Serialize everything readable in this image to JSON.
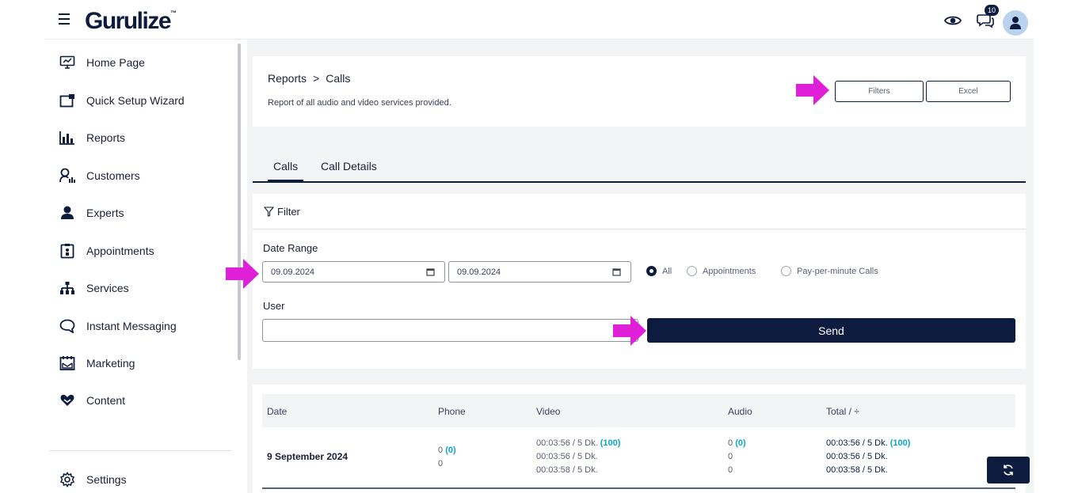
{
  "header": {
    "logo_text": "Gurulize",
    "logo_tm": "™",
    "notification_count": "10"
  },
  "sidebar": {
    "items": [
      {
        "label": "Home Page",
        "icon": "monitor-chart-icon"
      },
      {
        "label": "Quick Setup Wizard",
        "icon": "window-add-icon"
      },
      {
        "label": "Reports",
        "icon": "bar-chart-icon"
      },
      {
        "label": "Customers",
        "icon": "user-chart-icon"
      },
      {
        "label": "Experts",
        "icon": "user-icon"
      },
      {
        "label": "Appointments",
        "icon": "clipboard-user-icon"
      },
      {
        "label": "Services",
        "icon": "hierarchy-icon"
      },
      {
        "label": "Instant Messaging",
        "icon": "chat-bubble-icon"
      },
      {
        "label": "Marketing",
        "icon": "calendar-mail-icon"
      },
      {
        "label": "Content",
        "icon": "heart-hands-icon"
      }
    ],
    "settings_label": "Settings"
  },
  "page": {
    "breadcrumb_root": "Reports",
    "breadcrumb_sep": ">",
    "breadcrumb_current": "Calls",
    "subtitle": "Report of all audio and video services provided.",
    "filters_btn": "Filters",
    "excel_btn": "Excel"
  },
  "tabs": [
    "Calls",
    "Call Details"
  ],
  "filter": {
    "title": "Filter",
    "date_range_label": "Date Range",
    "date_from": "09.09.2024",
    "date_to": "09.09.2024",
    "radio_options": [
      {
        "label": "All",
        "checked": true
      },
      {
        "label": "Appointments",
        "checked": false
      },
      {
        "label": "Pay-per-minute Calls",
        "checked": false
      }
    ],
    "user_label": "User",
    "user_value": "",
    "send_btn": "Send"
  },
  "table": {
    "headers": [
      "Date",
      "Phone",
      "Video",
      "Audio",
      "Total / ÷"
    ],
    "rows": [
      {
        "date": "9 September 2024",
        "phone": [
          "0",
          "(0)",
          "0"
        ],
        "video": [
          "00:03:56 / 5 Dk.",
          "(100)",
          "00:03:56 / 5 Dk.",
          "00:03:58 / 5 Dk."
        ],
        "audio": [
          "0",
          "(0)",
          "0",
          "0"
        ],
        "total": [
          "00:03:56 / 5 Dk.",
          "(100)",
          "00:03:56 / 5 Dk.",
          "00:03:58 / 5 Dk."
        ]
      }
    ]
  },
  "colors": {
    "brand": "#0d1b3e",
    "accent": "#0aa5c9",
    "annotation_arrow": "#e01fd8"
  }
}
